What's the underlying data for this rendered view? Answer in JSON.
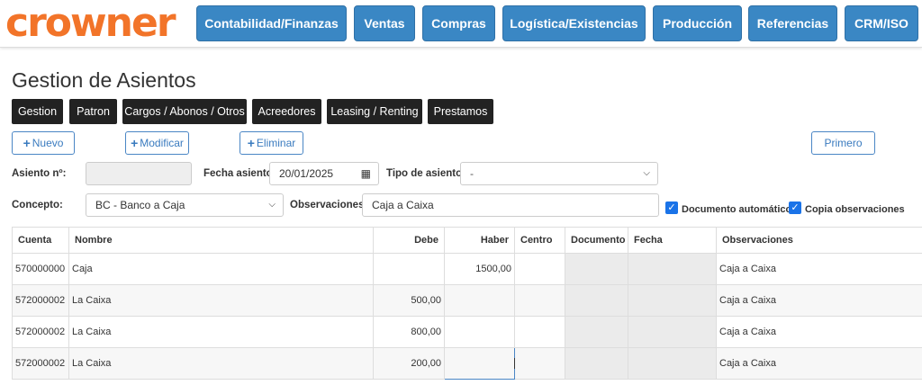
{
  "header": {
    "logo": "crowner",
    "nav": [
      "Contabilidad/Finanzas",
      "Ventas",
      "Compras",
      "Logística/Existencias",
      "Producción",
      "Referencias",
      "CRM/ISO"
    ]
  },
  "page_title": "Gestion de Asientos",
  "tabs": [
    "Gestion",
    "Patron",
    "Cargos / Abonos / Otros",
    "Acreedores",
    "Leasing / Renting",
    "Prestamos"
  ],
  "actions": {
    "nuevo": "Nuevo",
    "modificar": "Modificar",
    "eliminar": "Eliminar",
    "primero": "Primero"
  },
  "form": {
    "asiento_label": "Asiento nº:",
    "asiento_value": "",
    "fecha_label": "Fecha asiento:",
    "fecha_value": "20/01/2025",
    "tipo_label": "Tipo de asiento:",
    "tipo_value": "-",
    "concepto_label": "Concepto:",
    "concepto_value": "BC - Banco a Caja",
    "observaciones_label": "Observaciones:",
    "observaciones_value": "Caja a Caixa",
    "doc_auto_label": "Documento automático",
    "doc_auto_checked": true,
    "copia_obs_label": "Copia observaciones",
    "copia_obs_checked": true
  },
  "table": {
    "columns": [
      "Cuenta",
      "Nombre",
      "Debe",
      "Haber",
      "Centro",
      "Documento",
      "Fecha",
      "Observaciones"
    ],
    "rows": [
      {
        "cuenta": "570000000",
        "nombre": "Caja",
        "debe": "",
        "haber": "1500,00",
        "centro": "",
        "documento": "",
        "fecha": "",
        "observaciones": "Caja a Caixa"
      },
      {
        "cuenta": "572000002",
        "nombre": "La Caixa",
        "debe": "500,00",
        "haber": "",
        "centro": "",
        "documento": "",
        "fecha": "",
        "observaciones": "Caja a Caixa"
      },
      {
        "cuenta": "572000002",
        "nombre": "La Caixa",
        "debe": "800,00",
        "haber": "",
        "centro": "",
        "documento": "",
        "fecha": "",
        "observaciones": "Caja a Caixa"
      },
      {
        "cuenta": "572000002",
        "nombre": "La Caixa",
        "debe": "200,00",
        "haber": "",
        "centro": "",
        "documento": "",
        "fecha": "",
        "observaciones": "Caja a Caixa"
      }
    ]
  },
  "colors": {
    "brand": "#f27429",
    "nav": "#3a87c4",
    "tab": "#222222",
    "check": "#1a73e8"
  }
}
